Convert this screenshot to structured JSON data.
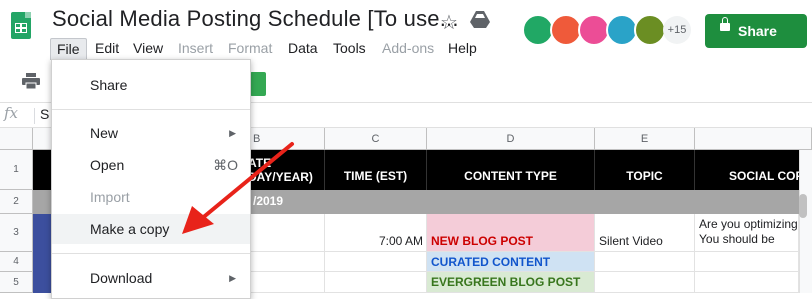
{
  "header": {
    "title": "Social Media Posting Schedule [To use...",
    "collaborators_more": "+15",
    "share_label": "Share"
  },
  "menubar": {
    "items": [
      {
        "label": "File"
      },
      {
        "label": "Edit"
      },
      {
        "label": "View"
      },
      {
        "label": "Insert"
      },
      {
        "label": "Format"
      },
      {
        "label": "Data"
      },
      {
        "label": "Tools"
      },
      {
        "label": "Add-ons"
      },
      {
        "label": "Help"
      }
    ]
  },
  "formula_bar": {
    "fx": "fx",
    "content": "S"
  },
  "grid": {
    "columns": [
      "B",
      "C",
      "D",
      "E"
    ],
    "rows": [
      "1",
      "2",
      "3",
      "4",
      "5"
    ],
    "header_row": {
      "b_partial": "ATE",
      "b_partial2": "DAY/YEAR)",
      "time": "TIME (EST)",
      "content_type": "CONTENT TYPE",
      "topic": "TOPIC",
      "social_copy": "SOCIAL COP"
    },
    "date_row": {
      "date_partial": "/2019"
    },
    "row3": {
      "time": "7:00 AM",
      "content_type": "NEW BLOG POST",
      "topic": "Silent Video",
      "copy_line1": "Are you optimizing",
      "copy_line2": "You should be"
    },
    "row4": {
      "content_type": "CURATED CONTENT"
    },
    "row5": {
      "content_type": "EVERGREEN BLOG POST"
    }
  },
  "file_menu": {
    "share": "Share",
    "new": "New",
    "open": "Open",
    "open_shortcut": "⌘O",
    "import": "Import",
    "make_copy": "Make a copy",
    "download": "Download"
  },
  "colors": {
    "share_button": "#1e8e3e",
    "new_blog_post_text": "#cc0000",
    "new_blog_post_bg": "#f4ccd8",
    "curated_text": "#1155cc",
    "curated_bg": "#cfe2f3",
    "evergreen_text": "#38761d",
    "evergreen_bg": "#d9ead3",
    "arrow": "#e8231a"
  }
}
